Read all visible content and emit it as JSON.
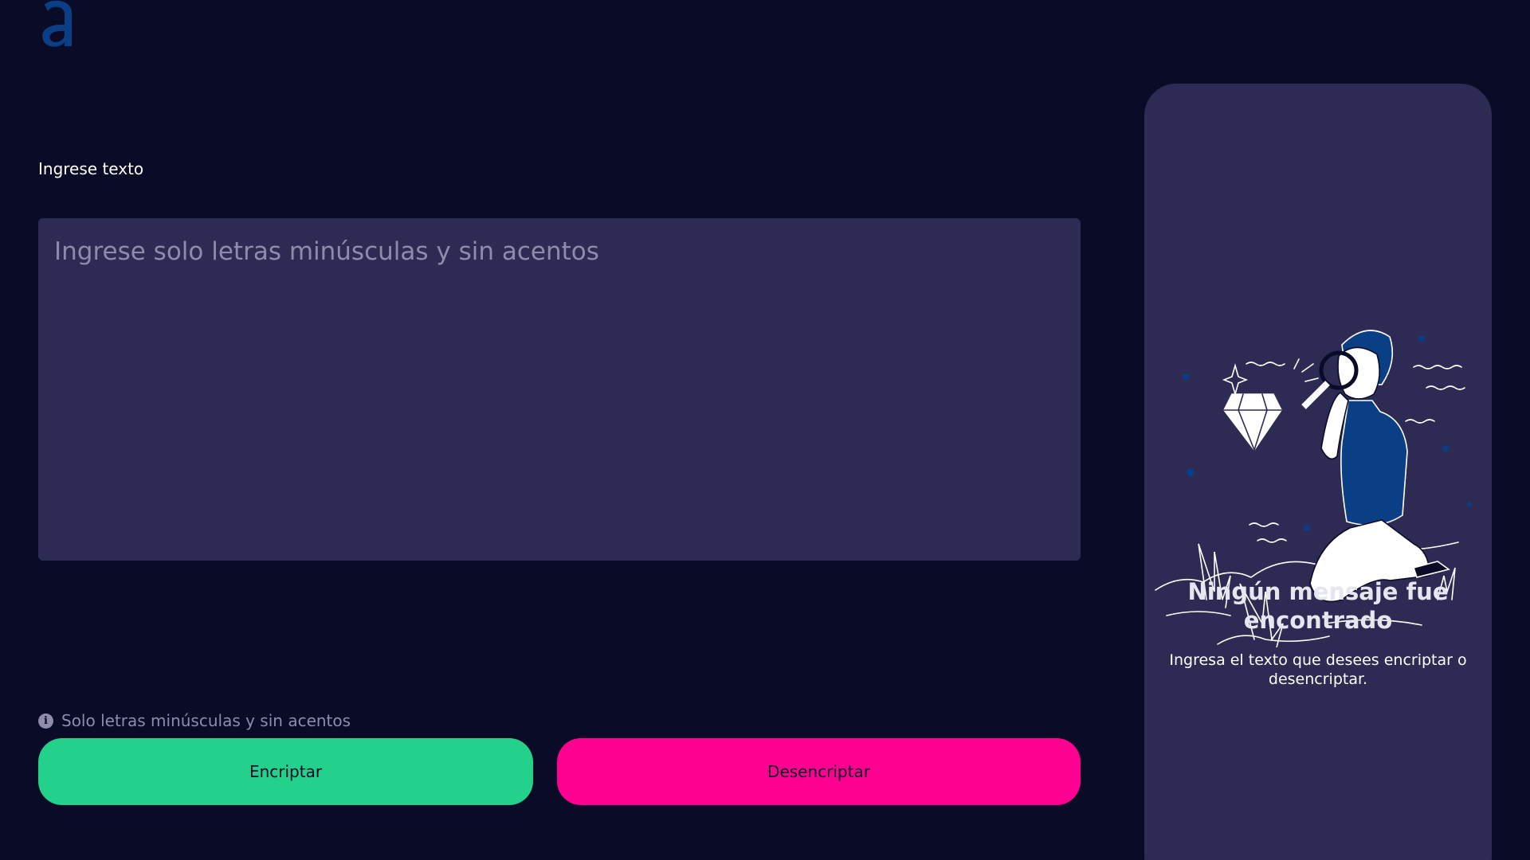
{
  "logo": {
    "letter": "a",
    "color": "#0a3e85"
  },
  "input": {
    "label": "Ingrese texto",
    "placeholder": "Ingrese solo letras minúsculas y sin acentos",
    "value": ""
  },
  "hint": {
    "icon": "info-icon",
    "text": "Solo letras minúsculas y sin acentos"
  },
  "buttons": {
    "encrypt_label": "Encriptar",
    "decrypt_label": "Desencriptar"
  },
  "result": {
    "title": "Ningún mensaje fue encontrado",
    "message": "Ingresa el texto que desees encriptar o desencriptar.",
    "illustration": "person-with-magnifying-glass-and-diamond"
  },
  "colors": {
    "background": "#0a0b26",
    "panel": "#2d2b53",
    "encrypt": "#24d18a",
    "decrypt": "#ff0090",
    "accent_blue": "#0a3e85"
  }
}
